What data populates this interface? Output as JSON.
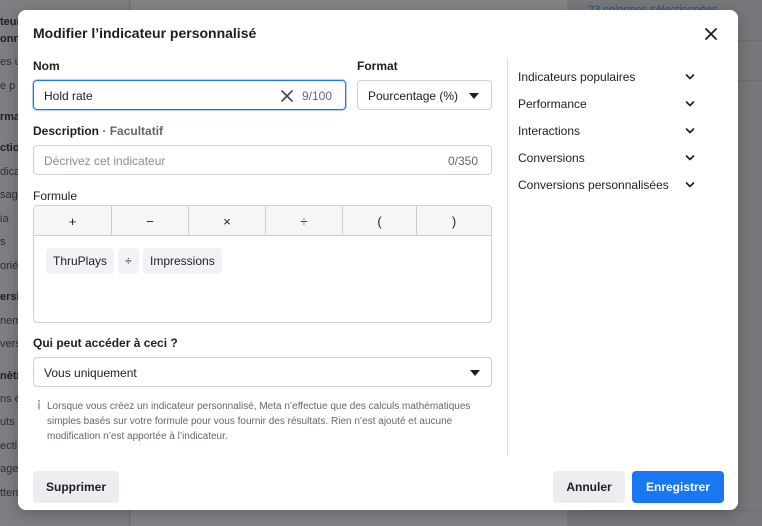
{
  "background": {
    "left_items": [
      "teur",
      "onna",
      "es ur",
      "e p",
      "rma",
      "ctio",
      "dica",
      "sag",
      "ia",
      "s",
      "orié",
      "ersi",
      "nem",
      "vers",
      "nètr",
      "ns e",
      "uts",
      "ecti",
      "age",
      "tten"
    ],
    "top_right_text": "23 colonnes sélectionnées"
  },
  "dialog": {
    "title": "Modifier l’indicateur personnalisé",
    "name_label": "Nom",
    "name_value": "Hold rate",
    "name_counter": "9/100",
    "format_label": "Format",
    "format_value": "Pourcentage (%)",
    "description_label": "Description",
    "description_optional": "· Facultatif",
    "description_placeholder": "Décrivez cet indicateur",
    "description_counter": "0/350",
    "formula_label": "Formule",
    "operators": [
      "+",
      "−",
      "×",
      "÷",
      "(",
      ")"
    ],
    "formula_tokens": [
      "ThruPlays",
      "÷",
      "Impressions"
    ],
    "access_label": "Qui peut accéder à ceci ?",
    "access_value": "Vous uniquement",
    "info_text": "Lorsque vous créez un indicateur personnalisé, Meta n’effectue que des calculs mathématiques simples basés sur votre formule pour vous fournir des résultats. Rien n’est ajouté et aucune modification n’est apportée à l’indicateur.",
    "metric_categories": [
      "Indicateurs populaires",
      "Performance",
      "Interactions",
      "Conversions",
      "Conversions personnalisées"
    ],
    "delete_label": "Supprimer",
    "cancel_label": "Annuler",
    "save_label": "Enregistrer"
  },
  "colors": {
    "primary": "#1877f2",
    "overlay": "#7b7d80"
  }
}
